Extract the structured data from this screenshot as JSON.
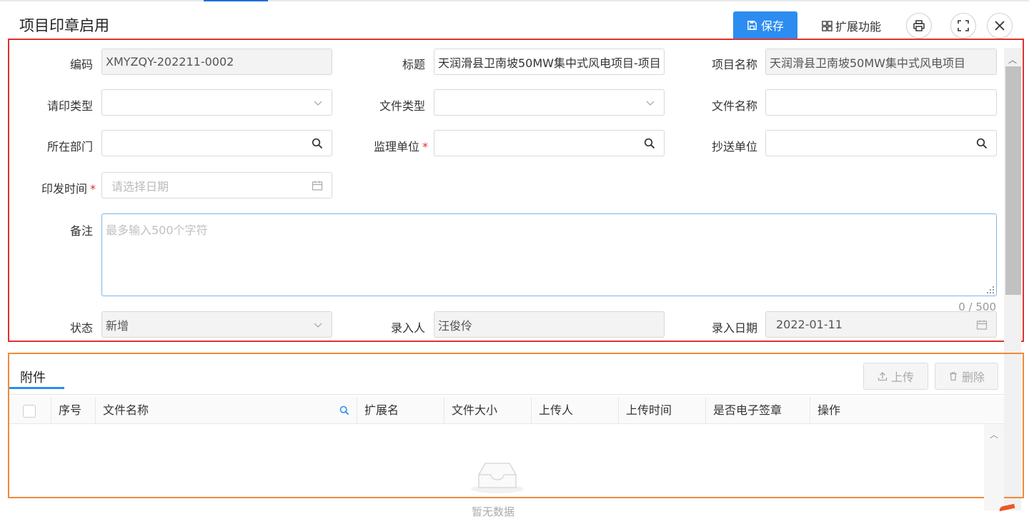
{
  "header": {
    "title": "项目印章启用",
    "save_label": "保存",
    "extend_label": "扩展功能"
  },
  "form": {
    "code": {
      "label": "编码",
      "value": "XMYZQY-202211-0002"
    },
    "subject": {
      "label": "标题",
      "value": "天润滑县卫南坡50MW集中式风电项目-项目"
    },
    "project_name": {
      "label": "项目名称",
      "value": "天润滑县卫南坡50MW集中式风电项目"
    },
    "seal_type": {
      "label": "请印类型",
      "value": ""
    },
    "file_type": {
      "label": "文件类型",
      "value": ""
    },
    "file_name": {
      "label": "文件名称",
      "value": ""
    },
    "department": {
      "label": "所在部门",
      "value": ""
    },
    "supervisor": {
      "label": "监理单位",
      "value": ""
    },
    "cc_unit": {
      "label": "抄送单位",
      "value": ""
    },
    "issue_date": {
      "label": "印发时间",
      "placeholder": "请选择日期"
    },
    "remark": {
      "label": "备注",
      "placeholder": "最多输入500个字符",
      "counter": "0 / 500"
    },
    "status": {
      "label": "状态",
      "value": "新增"
    },
    "entered_by": {
      "label": "录入人",
      "value": "汪俊伶"
    },
    "entry_date": {
      "label": "录入日期",
      "value": "2022-01-11"
    },
    "required_mark": "*"
  },
  "attachments": {
    "tab_label": "附件",
    "upload_label": "上传",
    "delete_label": "删除",
    "columns": [
      "序号",
      "文件名称",
      "扩展名",
      "文件大小",
      "上传人",
      "上传时间",
      "是否电子签章",
      "操作"
    ],
    "empty_text": "暂无数据"
  },
  "colors": {
    "primary": "#2d8cf0",
    "required": "#e0312f",
    "highlight_red": "#e0312f",
    "highlight_orange": "#f08a3a"
  }
}
